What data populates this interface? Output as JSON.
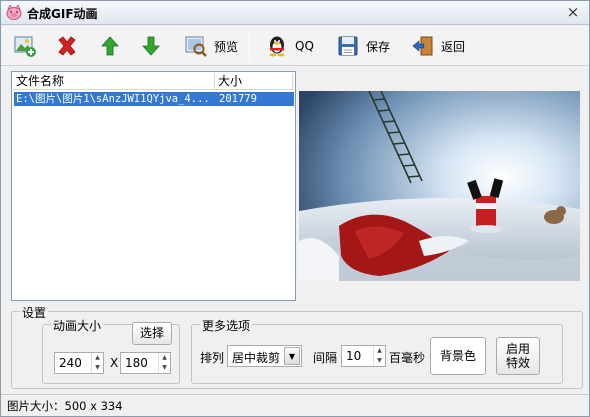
{
  "window": {
    "title": "合成GIF动画",
    "close_glyph": "×"
  },
  "toolbar": {
    "add_icon": "add-image-icon",
    "delete_icon": "delete-x-icon",
    "up_icon": "arrow-up-icon",
    "down_icon": "arrow-down-icon",
    "preview_label": "预览",
    "qq_label": "QQ",
    "save_label": "保存",
    "back_label": "返回"
  },
  "file_list": {
    "columns": [
      "文件名称",
      "大小"
    ],
    "rows": [
      {
        "name": "E:\\图片\\图片1\\sAnzJWI1QYjva_4...",
        "size": "201779",
        "selected": true
      }
    ]
  },
  "settings": {
    "group_title": "设置",
    "anim_size": {
      "title": "动画大小",
      "select_button": "选择",
      "width": "240",
      "separator": "X",
      "height": "180"
    },
    "more_options": {
      "title": "更多选项",
      "arrange_label": "排列",
      "arrange_value": "居中裁剪",
      "interval_label": "间隔",
      "interval_value": "10",
      "interval_unit": "百毫秒",
      "bg_color_button": "背景色",
      "effects_button_line1": "启用",
      "effects_button_line2": "特效"
    }
  },
  "status": {
    "text": "图片大小：500 x 334"
  },
  "colors": {
    "selection": "#3478d4",
    "delete_red": "#d42020",
    "arrow_green": "#2ea82e"
  }
}
